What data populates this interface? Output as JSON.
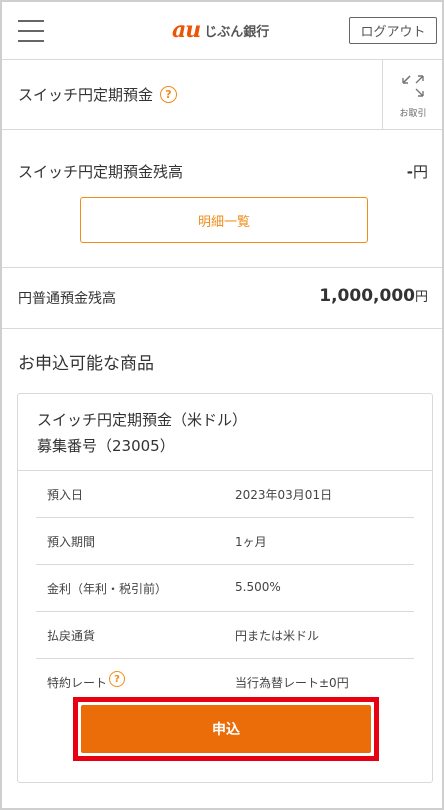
{
  "header": {
    "logo_mark": "au",
    "logo_text": "じぶん銀行",
    "logout_label": "ログアウト"
  },
  "product_header": {
    "title": "スイッチ円定期預金",
    "help_glyph": "?",
    "transactions_label": "お取引"
  },
  "balance": {
    "label": "スイッチ円定期預金残高",
    "value": "-",
    "unit": "円",
    "detail_button": "明細一覧"
  },
  "yen_balance": {
    "label": "円普通預金残高",
    "value": "1,000,000",
    "unit": "円"
  },
  "available_products": {
    "heading": "お申込可能な商品",
    "card": {
      "name": "スイッチ円定期預金（米ドル）",
      "number": "募集番号（23005）",
      "rows": [
        {
          "key": "預入日",
          "value": "2023年03月01日"
        },
        {
          "key": "預入期間",
          "value": "1ヶ月"
        },
        {
          "key": "金利（年利・税引前）",
          "value": "5.500%"
        },
        {
          "key": "払戻通貨",
          "value": "円または米ドル"
        },
        {
          "key": "特約レート",
          "value": "当行為替レート±0円"
        }
      ],
      "apply_button": "申込"
    }
  },
  "colors": {
    "accent": "#f08c1a",
    "apply": "#eb6d0a",
    "highlight": "#e60012"
  }
}
